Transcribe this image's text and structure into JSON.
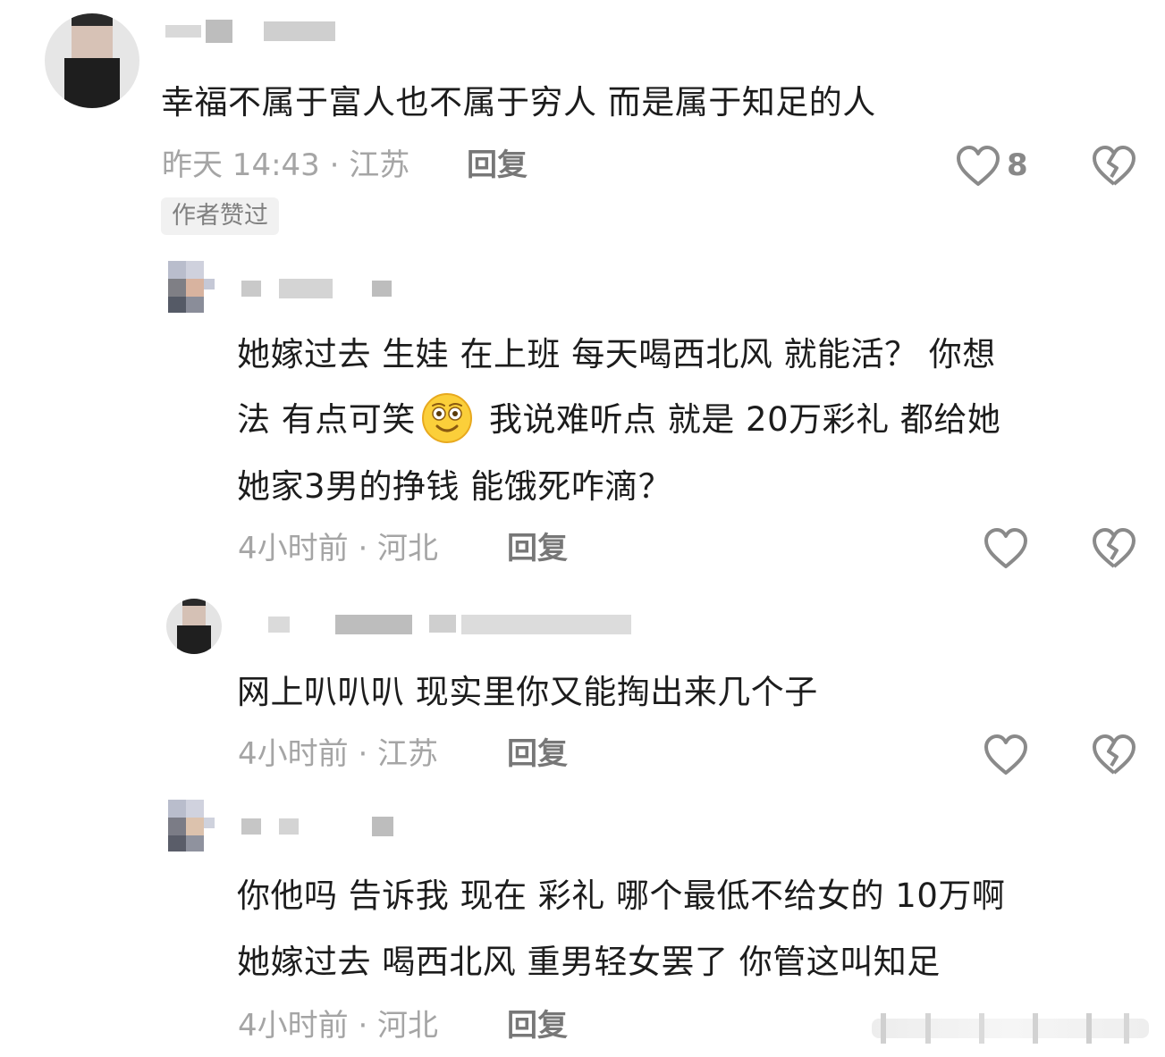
{
  "comments": [
    {
      "text": "幸福不属于富人也不属于穷人 而是属于知足的人",
      "meta": "昨天 14:43 · 江苏",
      "reply_label": "回复",
      "like_count": "8",
      "badge": "作者赞过"
    },
    {
      "lines": [
        "她嫁过去 生娃 在上班 每天喝西北风 就能活？ 你想",
        "法 有点可笑",
        " 我说难听点 就是 20万彩礼 都给她",
        "她家3男的挣钱 能饿死咋滴？"
      ],
      "meta": "4小时前 · 河北",
      "reply_label": "回复"
    },
    {
      "text": "网上叭叭叭 现实里你又能掏出来几个子",
      "meta": "4小时前 · 江苏",
      "reply_label": "回复"
    },
    {
      "lines": [
        "你他吗 告诉我 现在 彩礼 哪个最低不给女的 10万啊",
        "她嫁过去 喝西北风 重男轻女罢了 你管这叫知足"
      ],
      "meta": "4小时前 · 河北",
      "reply_label": "回复"
    }
  ],
  "colors": {
    "meta_gray": "#a5a5a5",
    "reply_gray": "#777777",
    "heart_gray": "#888888"
  },
  "icons": [
    "heart-outline-icon",
    "broken-heart-icon",
    "smile-emoji-icon"
  ]
}
